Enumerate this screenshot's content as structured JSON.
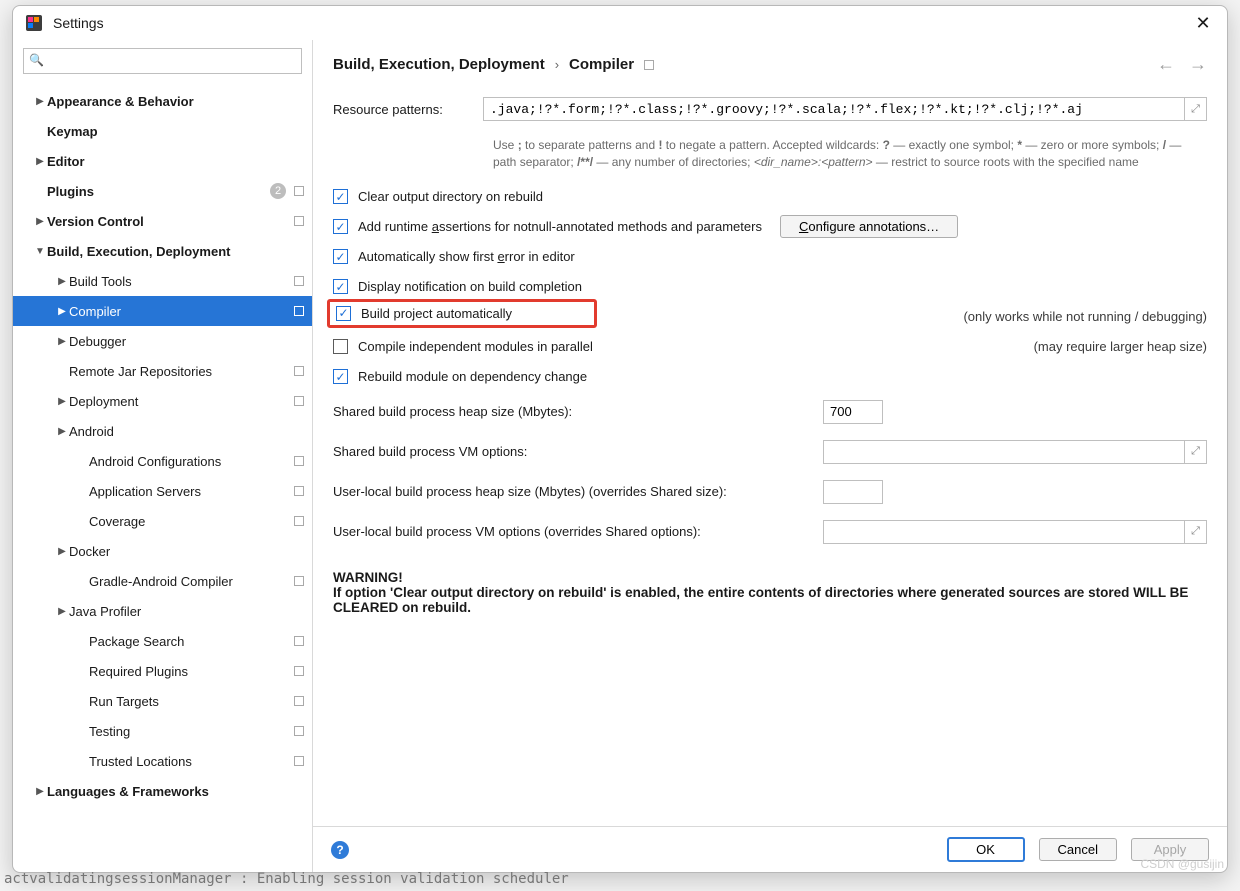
{
  "window": {
    "title": "Settings"
  },
  "search": {
    "placeholder": ""
  },
  "tree": [
    {
      "label": "Appearance & Behavior",
      "depth": 0,
      "caret": "right",
      "bold": true
    },
    {
      "label": "Keymap",
      "depth": 0,
      "caret": "",
      "bold": true
    },
    {
      "label": "Editor",
      "depth": 0,
      "caret": "right",
      "bold": true
    },
    {
      "label": "Plugins",
      "depth": 0,
      "caret": "",
      "bold": true,
      "badge": "2",
      "square": true
    },
    {
      "label": "Version Control",
      "depth": 0,
      "caret": "right",
      "bold": true,
      "square": true
    },
    {
      "label": "Build, Execution, Deployment",
      "depth": 0,
      "caret": "down",
      "bold": true
    },
    {
      "label": "Build Tools",
      "depth": 1,
      "caret": "right",
      "square": true
    },
    {
      "label": "Compiler",
      "depth": 1,
      "caret": "right",
      "square": true,
      "selected": true
    },
    {
      "label": "Debugger",
      "depth": 1,
      "caret": "right"
    },
    {
      "label": "Remote Jar Repositories",
      "depth": 1,
      "caret": "",
      "square": true
    },
    {
      "label": "Deployment",
      "depth": 1,
      "caret": "right",
      "square": true
    },
    {
      "label": "Android",
      "depth": 1,
      "caret": "right"
    },
    {
      "label": "Android Configurations",
      "depth": 2,
      "caret": "",
      "square": true
    },
    {
      "label": "Application Servers",
      "depth": 2,
      "caret": "",
      "square": true
    },
    {
      "label": "Coverage",
      "depth": 2,
      "caret": "",
      "square": true
    },
    {
      "label": "Docker",
      "depth": 1,
      "caret": "right"
    },
    {
      "label": "Gradle-Android Compiler",
      "depth": 2,
      "caret": "",
      "square": true
    },
    {
      "label": "Java Profiler",
      "depth": 1,
      "caret": "right"
    },
    {
      "label": "Package Search",
      "depth": 2,
      "caret": "",
      "square": true
    },
    {
      "label": "Required Plugins",
      "depth": 2,
      "caret": "",
      "square": true
    },
    {
      "label": "Run Targets",
      "depth": 2,
      "caret": "",
      "square": true
    },
    {
      "label": "Testing",
      "depth": 2,
      "caret": "",
      "square": true
    },
    {
      "label": "Trusted Locations",
      "depth": 2,
      "caret": "",
      "square": true
    },
    {
      "label": "Languages & Frameworks",
      "depth": 0,
      "caret": "right",
      "bold": true
    }
  ],
  "breadcrumb": {
    "group": "Build, Execution, Deployment",
    "page": "Compiler"
  },
  "resource": {
    "label": "Resource patterns:",
    "value": ".java;!?*.form;!?*.class;!?*.groovy;!?*.scala;!?*.flex;!?*.kt;!?*.clj;!?*.aj",
    "hint_a": "Use ",
    "hint_b": " to separate patterns and ",
    "hint_c": " to negate a pattern. Accepted wildcards: ",
    "hint_d": " — exactly one symbol; ",
    "hint_e": " — zero or more symbols; ",
    "hint_f": " — path separator; ",
    "hint_g": " — any number of directories; ",
    "hint_h": " — restrict to source roots with the specified name",
    "sym_semi": ";",
    "sym_bang": "!",
    "sym_q": "?",
    "sym_star": "*",
    "sym_slash": "/",
    "sym_dblstar": "/**/",
    "sym_dirpat": "<dir_name>:<pattern>"
  },
  "checkboxes": {
    "clear_output": "Clear output directory on rebuild",
    "add_runtime_a": "Add runtime ",
    "add_runtime_u": "a",
    "add_runtime_b": "ssertions for notnull-annotated methods and parameters",
    "configure_btn_a": "C",
    "configure_btn_b": "onfigure annotations…",
    "auto_first_a": "Automatically show first ",
    "auto_first_u": "e",
    "auto_first_b": "rror in editor",
    "display_notif": "Display notification on build completion",
    "build_auto": "Build project automatically",
    "build_auto_note": "(only works while not running / debugging)",
    "compile_parallel": "Compile independent modules in parallel",
    "compile_parallel_note": "(may require larger heap size)",
    "rebuild_dep": "Rebuild module on dependency change"
  },
  "fields": {
    "heap_label": "Shared build process heap size (Mbytes):",
    "heap_value": "700",
    "vm_label": "Shared build process VM options:",
    "vm_value": "",
    "user_heap_label": "User-local build process heap size (Mbytes) (overrides Shared size):",
    "user_heap_value": "",
    "user_vm_label": "User-local build process VM options (overrides Shared options):",
    "user_vm_value": ""
  },
  "warning": {
    "title": "WARNING!",
    "text": "If option 'Clear output directory on rebuild' is enabled, the entire contents of directories where generated sources are stored WILL BE CLEARED on rebuild."
  },
  "footer": {
    "ok": "OK",
    "cancel": "Cancel",
    "apply": "Apply"
  },
  "watermark": "CSDN @gusijin",
  "bgtext": "actvalidatingsessionManager : Enabling session validation scheduler"
}
